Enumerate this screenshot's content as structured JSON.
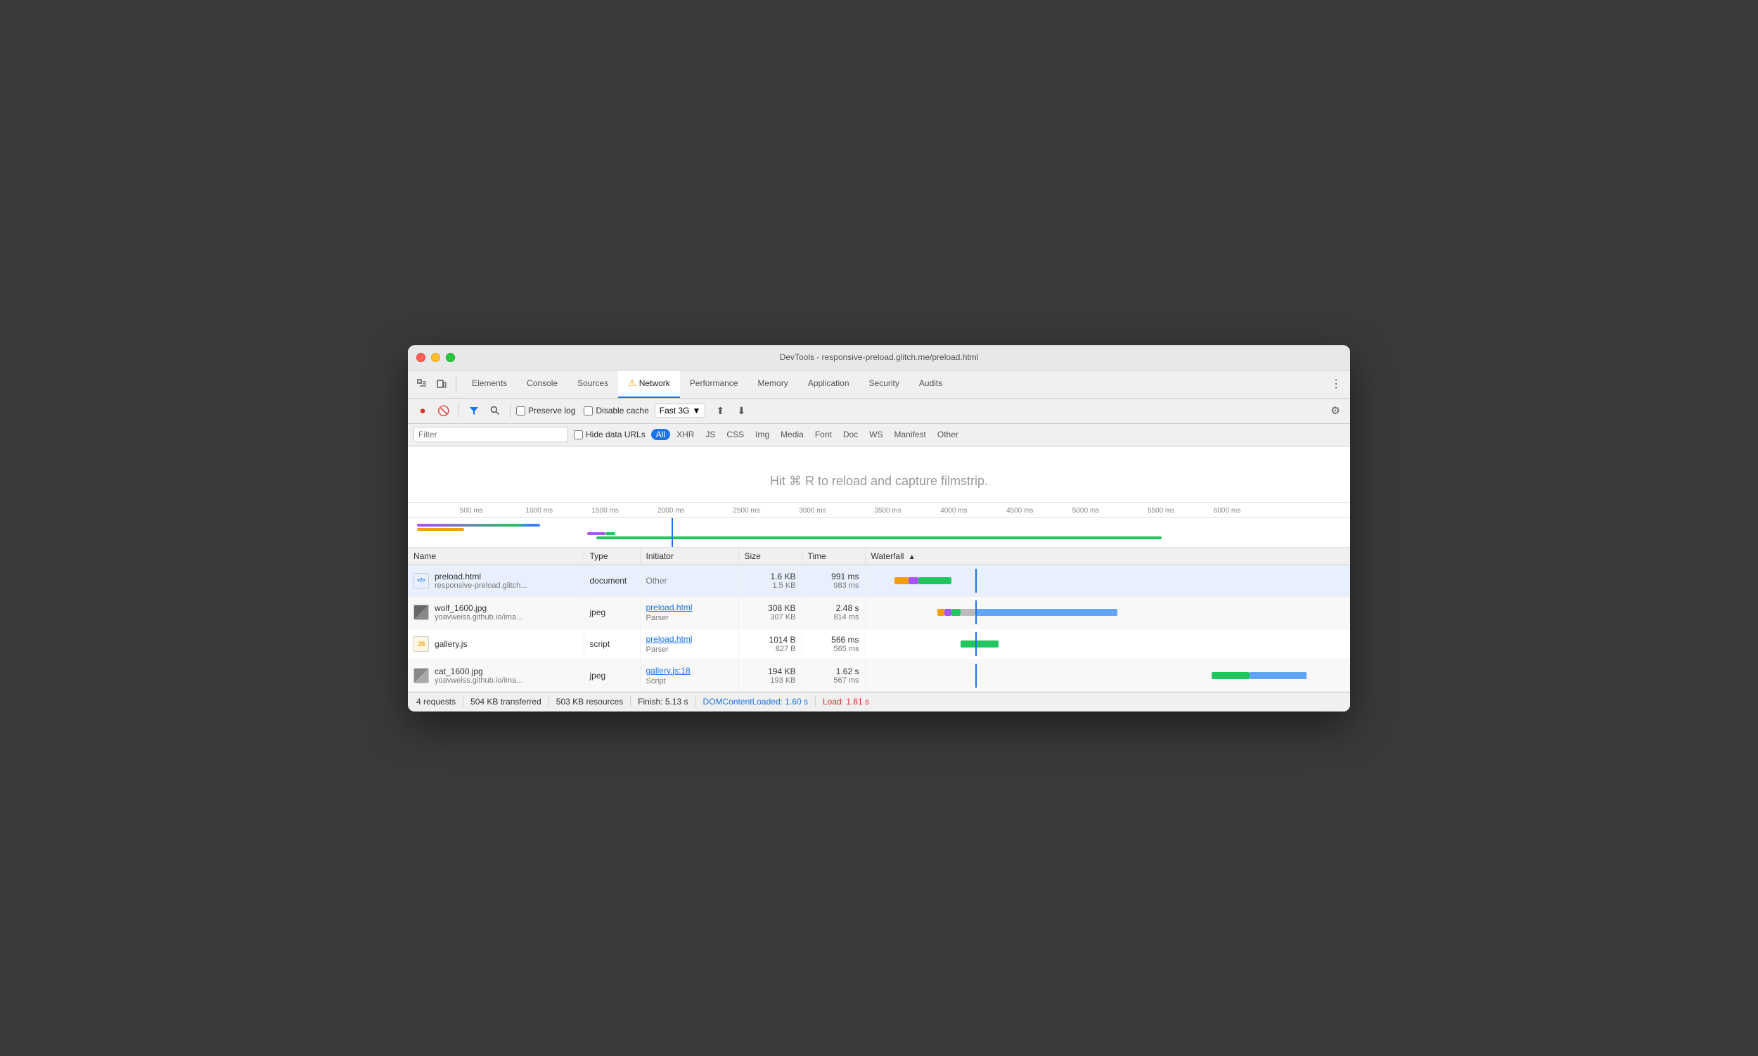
{
  "window": {
    "title": "DevTools - responsive-preload.glitch.me/preload.html"
  },
  "traffic_lights": [
    "red",
    "yellow",
    "green"
  ],
  "tabs": [
    {
      "label": "Elements",
      "active": false
    },
    {
      "label": "Console",
      "active": false
    },
    {
      "label": "Sources",
      "active": false
    },
    {
      "label": "Network",
      "active": true,
      "warning": true
    },
    {
      "label": "Performance",
      "active": false
    },
    {
      "label": "Memory",
      "active": false
    },
    {
      "label": "Application",
      "active": false
    },
    {
      "label": "Security",
      "active": false
    },
    {
      "label": "Audits",
      "active": false
    }
  ],
  "toolbar": {
    "preserve_log_label": "Preserve log",
    "disable_cache_label": "Disable cache",
    "throttle": "Fast 3G",
    "settings_label": "Settings"
  },
  "filter": {
    "placeholder": "Filter",
    "hide_data_urls_label": "Hide data URLs",
    "types": [
      "All",
      "XHR",
      "JS",
      "CSS",
      "Img",
      "Media",
      "Font",
      "Doc",
      "WS",
      "Manifest",
      "Other"
    ],
    "active_type": "All"
  },
  "filmstrip": {
    "message": "Hit ⌘ R to reload and capture filmstrip."
  },
  "timeline": {
    "ticks": [
      {
        "label": "500 ms",
        "left_pct": 7
      },
      {
        "label": "1000 ms",
        "left_pct": 14
      },
      {
        "label": "1500 ms",
        "left_pct": 21
      },
      {
        "label": "2000 ms",
        "left_pct": 28
      },
      {
        "label": "2500 ms",
        "left_pct": 36
      },
      {
        "label": "3000 ms",
        "left_pct": 43
      },
      {
        "label": "3500 ms",
        "left_pct": 51
      },
      {
        "label": "4000 ms",
        "left_pct": 58
      },
      {
        "label": "4500 ms",
        "left_pct": 65
      },
      {
        "label": "5000 ms",
        "left_pct": 72
      },
      {
        "label": "5500 ms",
        "left_pct": 80
      },
      {
        "label": "6000 ms",
        "left_pct": 87
      }
    ],
    "cursor_left_pct": 28
  },
  "table": {
    "columns": [
      "Name",
      "Type",
      "Initiator",
      "Size",
      "Time",
      "Waterfall"
    ],
    "rows": [
      {
        "name": "preload.html",
        "url": "responsive-preload.glitch...",
        "type": "document",
        "initiator": "Other",
        "initiator_link": null,
        "size1": "1.6 KB",
        "size2": "1.5 KB",
        "time1": "991 ms",
        "time2": "983 ms",
        "selected": true,
        "icon_type": "doc"
      },
      {
        "name": "wolf_1600.jpg",
        "url": "yoavweiss.github.io/ima...",
        "type": "jpeg",
        "initiator": "preload.html",
        "initiator_sub": "Parser",
        "initiator_link": true,
        "size1": "308 KB",
        "size2": "307 KB",
        "time1": "2.48 s",
        "time2": "814 ms",
        "selected": false,
        "icon_type": "img"
      },
      {
        "name": "gallery.js",
        "url": "",
        "type": "script",
        "initiator": "preload.html",
        "initiator_sub": "Parser",
        "initiator_link": true,
        "size1": "1014 B",
        "size2": "827 B",
        "time1": "566 ms",
        "time2": "565 ms",
        "selected": false,
        "icon_type": "js"
      },
      {
        "name": "cat_1600.jpg",
        "url": "yoavweiss.github.io/ima...",
        "type": "jpeg",
        "initiator": "gallery.js:18",
        "initiator_sub": "Script",
        "initiator_link": true,
        "size1": "194 KB",
        "size2": "193 KB",
        "time1": "1.62 s",
        "time2": "567 ms",
        "selected": false,
        "icon_type": "img"
      }
    ]
  },
  "status_bar": {
    "requests": "4 requests",
    "transferred": "504 KB transferred",
    "resources": "503 KB resources",
    "finish": "Finish: 5.13 s",
    "dom_content_loaded": "DOMContentLoaded: 1.60 s",
    "load": "Load: 1.61 s"
  }
}
